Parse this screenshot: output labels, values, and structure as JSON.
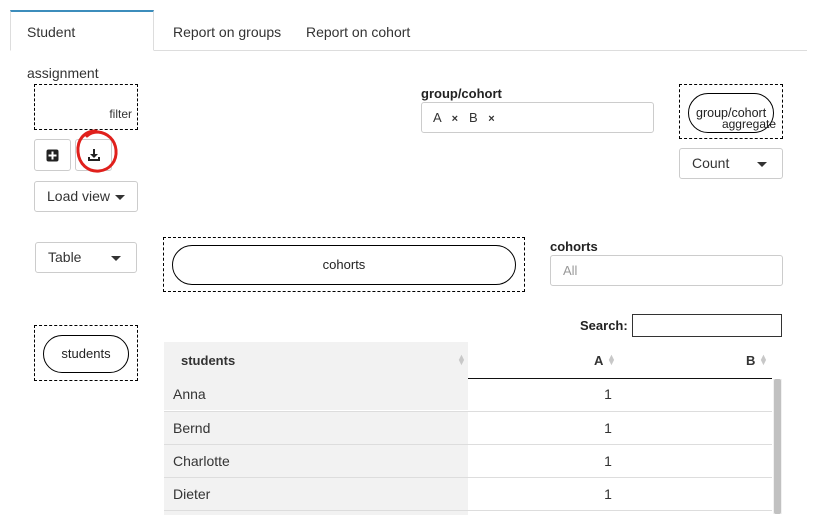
{
  "tabs": [
    {
      "label": "Student assignment",
      "active": true
    },
    {
      "label": "Report on groups",
      "active": false
    },
    {
      "label": "Report on cohort",
      "active": false
    }
  ],
  "filter_zone": {
    "label": "filter"
  },
  "toolbar": {
    "add_icon": "plus-square-icon",
    "download_icon": "download-icon"
  },
  "load_view": {
    "label": "Load view"
  },
  "group_cohort": {
    "label": "group/cohort",
    "selected": [
      {
        "label": "A"
      },
      {
        "label": "B"
      }
    ],
    "remove_glyph": "×"
  },
  "aggregate_zone": {
    "pill_label": "group/cohort",
    "label": "aggregate"
  },
  "aggregate_select": {
    "value": "Count"
  },
  "renderer_select": {
    "value": "Table"
  },
  "cols_zone": {
    "pill_label": "cohorts"
  },
  "cohorts_filter": {
    "label": "cohorts",
    "placeholder": "All"
  },
  "rows_zone": {
    "pill_label": "students"
  },
  "table": {
    "search_label": "Search:",
    "columns": [
      "students",
      "A",
      "B"
    ],
    "rows": [
      {
        "name": "Anna",
        "a": "1",
        "b": ""
      },
      {
        "name": "Bernd",
        "a": "1",
        "b": ""
      },
      {
        "name": "Charlotte",
        "a": "1",
        "b": ""
      },
      {
        "name": "Dieter",
        "a": "1",
        "b": ""
      }
    ]
  },
  "annotation_color": "#e0201c",
  "accent": "#3c8dbc"
}
